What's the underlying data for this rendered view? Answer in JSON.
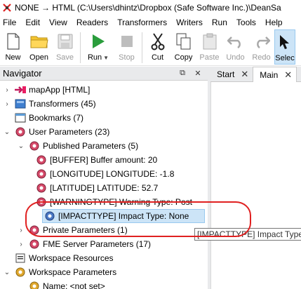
{
  "window": {
    "title": "NONE → HTML (C:\\Users\\dhintz\\Dropbox (Safe Software Inc.)\\DeanSa"
  },
  "menubar": {
    "items": [
      "File",
      "Edit",
      "View",
      "Readers",
      "Transformers",
      "Writers",
      "Run",
      "Tools",
      "Help"
    ]
  },
  "toolbar": {
    "new": "New",
    "open": "Open",
    "save": "Save",
    "run": "Run",
    "stop": "Stop",
    "cut": "Cut",
    "copy": "Copy",
    "paste": "Paste",
    "undo": "Undo",
    "redo": "Redo",
    "select": "Selec"
  },
  "navigator": {
    "title": "Navigator",
    "items": [
      "mapApp [HTML]",
      "Transformers (45)",
      "Bookmarks (7)",
      "User Parameters (23)",
      "Published Parameters (5)",
      "[BUFFER] Buffer amount: 20",
      "[LONGITUDE] LONGITUDE: -1.8",
      "[LATITUDE] LATITUDE: 52.7",
      "[WARNINGTYPE] Warning Type: Post",
      "[IMPACTTYPE] Impact Type: None",
      "Private Parameters (1)",
      "FME Server Parameters (17)",
      "Workspace Resources",
      "Workspace Parameters",
      "Name: <not set>"
    ]
  },
  "tabs": {
    "start": "Start",
    "main": "Main"
  },
  "tooltip": {
    "text": "[IMPACTTYPE] Impact Type:"
  },
  "colors": {
    "annotation": "#e02020",
    "selection": "#cce4f7",
    "run_green": "#2a9d3c"
  }
}
